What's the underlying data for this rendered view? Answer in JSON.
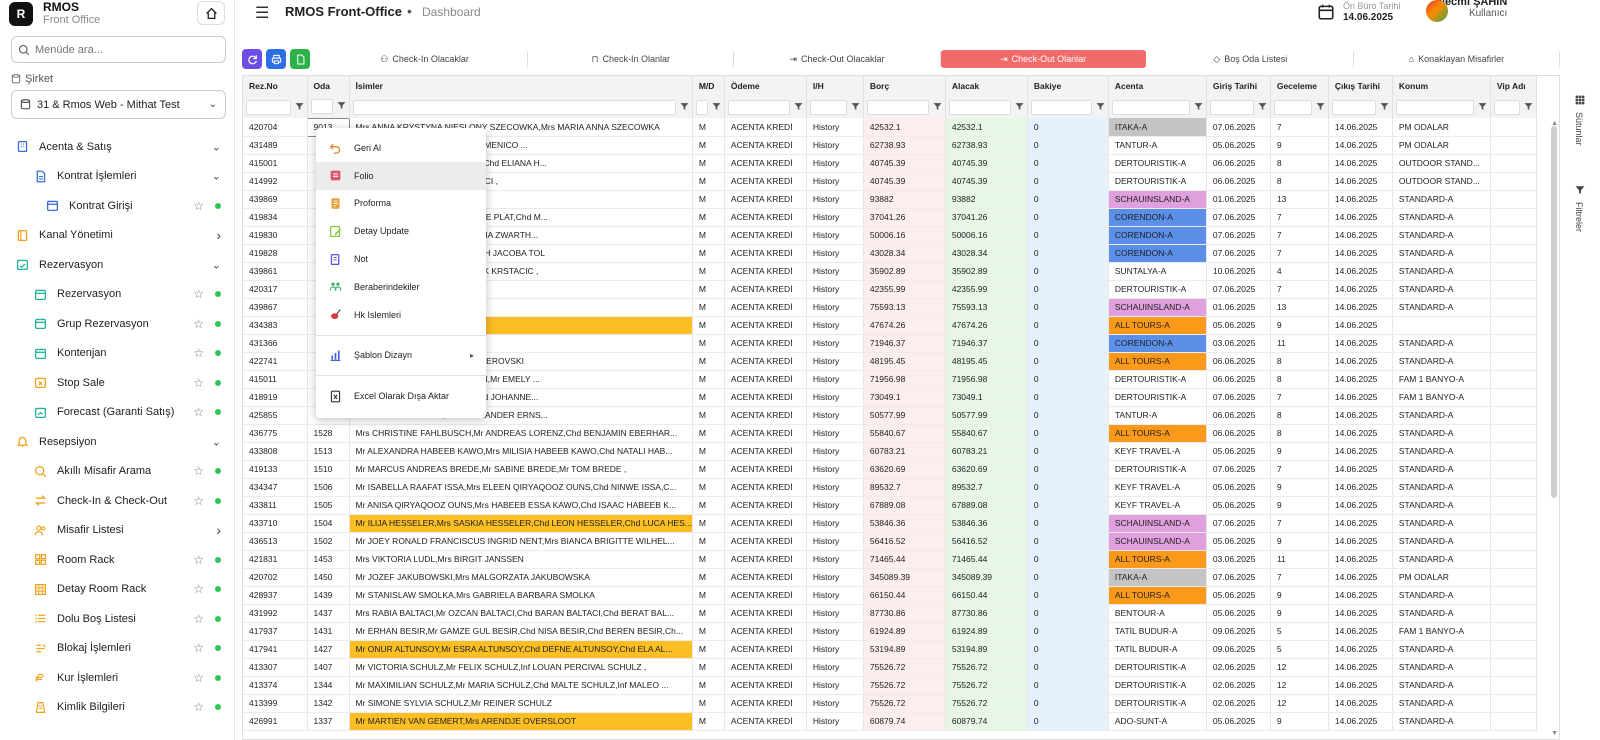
{
  "brand": {
    "name": "RMOS",
    "subtitle": "Front Office",
    "logo_letter": "R"
  },
  "sidebar": {
    "search_placeholder": "Menüde ara...",
    "company_label": "Şirket",
    "company_value": "31 & Rmos Web - Mithat Test",
    "items": [
      {
        "label": "Acenta & Satış",
        "icon": "building-icon",
        "level": 0,
        "chevron": "down",
        "star": false,
        "dot": false
      },
      {
        "label": "Kontrat İşlemleri",
        "icon": "document-icon",
        "level": 1,
        "chevron": "down",
        "star": false,
        "dot": false
      },
      {
        "label": "Kontrat Girişi",
        "icon": "calendar-icon",
        "level": 2,
        "chevron": "",
        "star": true,
        "dot": true
      },
      {
        "label": "Kanal Yönetimi",
        "icon": "book-icon",
        "level": 0,
        "chevron": "right",
        "star": false,
        "dot": false
      },
      {
        "label": "Rezervasyon",
        "icon": "calendar-check-icon",
        "level": 0,
        "chevron": "down",
        "star": false,
        "dot": false
      },
      {
        "label": "Rezervasyon",
        "icon": "calendar-icon",
        "level": 1,
        "chevron": "",
        "star": true,
        "dot": true
      },
      {
        "label": "Grup Rezervasyon",
        "icon": "calendar-icon",
        "level": 1,
        "chevron": "",
        "star": true,
        "dot": true
      },
      {
        "label": "Kontenjan",
        "icon": "calendar-icon",
        "level": 1,
        "chevron": "",
        "star": true,
        "dot": true
      },
      {
        "label": "Stop Sale",
        "icon": "stop-icon",
        "level": 1,
        "chevron": "",
        "star": true,
        "dot": true
      },
      {
        "label": "Forecast (Garanti Satış)",
        "icon": "forecast-icon",
        "level": 1,
        "chevron": "",
        "star": true,
        "dot": true
      },
      {
        "label": "Resepsiyon",
        "icon": "bell-icon",
        "level": 0,
        "chevron": "down",
        "star": false,
        "dot": false
      },
      {
        "label": "Akıllı Misafir Arama",
        "icon": "search-icon",
        "level": 1,
        "chevron": "",
        "star": true,
        "dot": true
      },
      {
        "label": "Check-In & Check-Out",
        "icon": "swap-icon",
        "level": 1,
        "chevron": "",
        "star": true,
        "dot": true
      },
      {
        "label": "Misafir Listesi",
        "icon": "users-icon",
        "level": 1,
        "chevron": "right",
        "star": false,
        "dot": false
      },
      {
        "label": "Room Rack",
        "icon": "grid-icon",
        "level": 1,
        "chevron": "",
        "star": true,
        "dot": true
      },
      {
        "label": "Detay Room Rack",
        "icon": "table-icon",
        "level": 1,
        "chevron": "",
        "star": true,
        "dot": true
      },
      {
        "label": "Dolu Boş Listesi",
        "icon": "list-icon",
        "level": 1,
        "chevron": "",
        "star": true,
        "dot": true
      },
      {
        "label": "Blokaj İşlemleri",
        "icon": "block-icon",
        "level": 1,
        "chevron": "",
        "star": true,
        "dot": true
      },
      {
        "label": "Kur İşlemleri",
        "icon": "currency-icon",
        "level": 1,
        "chevron": "",
        "star": true,
        "dot": true
      },
      {
        "label": "Kimlik Bilgileri",
        "icon": "id-card-icon",
        "level": 1,
        "chevron": "",
        "star": true,
        "dot": true
      }
    ]
  },
  "header": {
    "app_title": "RMOS Front-Office",
    "breadcrumb": "Dashboard",
    "date_label": "Ön Büro Tarihi",
    "date_value": "14.06.2025",
    "user_name": "Necmi ŞAHİN",
    "user_role": "Kullanıcı"
  },
  "toolbar": {
    "tabs": [
      {
        "label": "Check-In Olacaklar",
        "icon": "user-check-icon",
        "active": false
      },
      {
        "label": "Check-In Olanlar",
        "icon": "door-icon",
        "active": false
      },
      {
        "label": "Check-Out Olacaklar",
        "icon": "logout-icon",
        "active": false
      },
      {
        "label": "Check-Out Olanlar",
        "icon": "logout-icon",
        "active": true
      },
      {
        "label": "Boş Oda Listesi",
        "icon": "shield-icon",
        "active": false
      },
      {
        "label": "Konaklayan Misafirler",
        "icon": "home-icon",
        "active": false
      }
    ],
    "colors": {
      "refresh": "#6d4de6",
      "print": "#2f6fe6",
      "excel": "#2bb34a",
      "active_tab": "#f26b6b"
    }
  },
  "grid": {
    "columns": [
      "Rez.No",
      "Oda",
      "İsimler",
      "M/D",
      "Ödeme",
      "I/H",
      "Borç",
      "Alacak",
      "Bakiye",
      "Acenta",
      "Giriş Tarihi",
      "Geceleme",
      "Çıkış Tarihi",
      "Konum",
      "Vip Adı"
    ],
    "agency_colors": {
      "gray": "#c4c4c4",
      "pink": "#e0a0dd",
      "blue": "#5b8fe8",
      "orange": "#fb9a1a"
    },
    "rows": [
      [
        "420704",
        "9013",
        "Mrs ANNA KRYSTYNA NIESLONY SZECOWKA,Mrs MARIA ANNA SZECOWKA",
        "M",
        "ACENTA KREDİ",
        "History",
        "42532.1",
        "42532.1",
        "0",
        "ITAKA-A",
        "07.06.2025",
        "7",
        "14.06.2025",
        "PM ODALAR",
        "",
        "gray",
        false
      ],
      [
        "431489",
        "",
        "Mr ANTONIO LA MANNA,Chd DOMENICO ...",
        "M",
        "ACENTA KREDİ",
        "History",
        "62738.93",
        "62738.93",
        "0",
        "TANTUR-A",
        "05.06.2025",
        "9",
        "14.06.2025",
        "PM ODALAR",
        "",
        "",
        false
      ],
      [
        "415001",
        "",
        "ANIE HORNBERGER FECHTER,Chd ELIANA H...",
        "M",
        "ACENTA KREDİ",
        "History",
        "40745.39",
        "40745.39",
        "0",
        "DERTOURISTIK-A",
        "06.06.2025",
        "8",
        "14.06.2025",
        "OUTDOOR STAND...",
        "",
        "",
        false
      ],
      [
        "414992",
        "",
        "ABANCI,Inf CAN HIKMET SABANCI ,",
        "M",
        "ACENTA KREDİ",
        "History",
        "40745.39",
        "40745.39",
        "0",
        "DERTOURISTIK-A",
        "06.06.2025",
        "8",
        "14.06.2025",
        "OUTDOOR STAND...",
        "",
        "",
        false
      ],
      [
        "439869",
        "",
        "O GASHI,Mrs JENNIFER GASHI ,",
        "M",
        "ACENTA KREDİ",
        "History",
        "93882",
        "93882",
        "0",
        "SCHAUINSLAND-A",
        "01.06.2025",
        "13",
        "14.06.2025",
        "STANDARD-A",
        "",
        "pink",
        false
      ],
      [
        "419834",
        "",
        "NNES RUNDERKAMP,Mrs DENISE PLAT,Chd M...",
        "M",
        "ACENTA KREDİ",
        "History",
        "37041.26",
        "37041.26",
        "0",
        "CORENDON-A",
        "07.06.2025",
        "7",
        "14.06.2025",
        "STANDARD-A",
        "",
        "blue",
        false
      ],
      [
        "419830",
        "",
        "ZUNDERKAMP,Mrs GEZINA MARIA ZWARTH...",
        "M",
        "ACENTA KREDİ",
        "History",
        "50006.16",
        "50006.16",
        "0",
        "CORENDON-A",
        "07.06.2025",
        "7",
        "14.06.2025",
        "STANDARD-A",
        "",
        "blue",
        false
      ],
      [
        "419828",
        "",
        "IDERKAMP,Mrs ALIDA ELISABETH JACOBA TOL",
        "M",
        "ACENTA KREDİ",
        "History",
        "43028.34",
        "43028.34",
        "0",
        "CORENDON-A",
        "07.06.2025",
        "7",
        "14.06.2025",
        "STANDARD-A",
        "",
        "blue",
        false
      ],
      [
        "439861",
        "",
        "TIJAN KRSTACIC,Mr DEJAN RICK KRSTACIC ,",
        "M",
        "ACENTA KREDİ",
        "History",
        "35902.89",
        "35902.89",
        "0",
        "SUNTALYA-A",
        "10.06.2025",
        "4",
        "14.06.2025",
        "STANDARD-A",
        "",
        "",
        false
      ],
      [
        "420317",
        "",
        "BINIAN LUCIUS RICHA PICKAR",
        "M",
        "ACENTA KREDİ",
        "History",
        "42355.99",
        "42355.99",
        "0",
        "DERTOURISTIK-A",
        "07.06.2025",
        "7",
        "14.06.2025",
        "STANDARD-A",
        "",
        "",
        false
      ],
      [
        "439867",
        "",
        "SHI",
        "M",
        "ACENTA KREDİ",
        "History",
        "75593.13",
        "75593.13",
        "0",
        "SCHAUINSLAND-A",
        "01.06.2025",
        "13",
        "14.06.2025",
        "STANDARD-A",
        "",
        "pink",
        false
      ],
      [
        "434383",
        "",
        "",
        "M",
        "ACENTA KREDİ",
        "History",
        "47674.26",
        "47674.26",
        "0",
        "ALL TOURS-A",
        "05.06.2025",
        "9",
        "14.06.2025",
        "",
        "",
        "orange",
        true
      ],
      [
        "431366",
        "",
        "BENJAMINS",
        "M",
        "ACENTA KREDİ",
        "History",
        "71946.37",
        "71946.37",
        "0",
        "CORENDON-A",
        "03.06.2025",
        "11",
        "14.06.2025",
        "STANDARD-A",
        "",
        "blue",
        false
      ],
      [
        "422741",
        "",
        "VSKI,Mrs KATHRIN ELKE SKENDEROVSKI",
        "M",
        "ACENTA KREDİ",
        "History",
        "48195.45",
        "48195.45",
        "0",
        "ALL TOURS-A",
        "06.06.2025",
        "8",
        "14.06.2025",
        "STANDARD-A",
        "",
        "orange",
        false
      ],
      [
        "415011",
        "",
        "ANGELINA RUTH GEISSELMANN,Mr EMELY ...",
        "M",
        "ACENTA KREDİ",
        "History",
        "71956.98",
        "71956.98",
        "0",
        "DERTOURISTIK-A",
        "06.06.2025",
        "8",
        "14.06.2025",
        "FAM 1 BANYO-A",
        "",
        "",
        false
      ],
      [
        "418919",
        "",
        "MAAG,Mr SEBASTIAN MAAG,Chd JOHANNE...",
        "M",
        "ACENTA KREDİ",
        "History",
        "73049.1",
        "73049.1",
        "0",
        "DERTOURISTIK-A",
        "07.06.2025",
        "7",
        "14.06.2025",
        "FAM 1 BANYO-A",
        "",
        "",
        false
      ],
      [
        "425855",
        "",
        "Mr MARIUSZ LIPINSKI,Chd ALEXANDER ERNS...",
        "M",
        "ACENTA KREDİ",
        "History",
        "50577.99",
        "50577.99",
        "0",
        "TANTUR-A",
        "06.06.2025",
        "8",
        "14.06.2025",
        "STANDARD-A",
        "",
        "",
        false
      ],
      [
        "436775",
        "1528",
        "Mrs CHRISTINE FAHLBUSCH,Mr ANDREAS LORENZ,Chd BENJAMIN EBERHAR...",
        "M",
        "ACENTA KREDİ",
        "History",
        "55840.67",
        "55840.67",
        "0",
        "ALL TOURS-A",
        "06.06.2025",
        "8",
        "14.06.2025",
        "STANDARD-A",
        "",
        "orange",
        false
      ],
      [
        "433808",
        "1513",
        "Mr ALEXANDRA HABEEB KAWO,Mrs MILISIA HABEEB KAWO,Chd NATALI HAB...",
        "M",
        "ACENTA KREDİ",
        "History",
        "60783.21",
        "60783.21",
        "0",
        "KEYF TRAVEL-A",
        "05.06.2025",
        "9",
        "14.06.2025",
        "STANDARD-A",
        "",
        "",
        false
      ],
      [
        "419133",
        "1510",
        "Mr MARCUS ANDREAS BREDE,Mr SABINE BREDE,Mr TOM BREDE ,",
        "M",
        "ACENTA KREDİ",
        "History",
        "63620.69",
        "63620.69",
        "0",
        "DERTOURISTIK-A",
        "07.06.2025",
        "7",
        "14.06.2025",
        "STANDARD-A",
        "",
        "",
        false
      ],
      [
        "434347",
        "1506",
        "Mr ISABELLA RAAFAT ISSA,Mrs ELEEN QIRYAQOOZ OUNS,Chd NINWE ISSA,C...",
        "M",
        "ACENTA KREDİ",
        "History",
        "89532.7",
        "89532.7",
        "0",
        "KEYF TRAVEL-A",
        "05.06.2025",
        "9",
        "14.06.2025",
        "STANDARD-A",
        "",
        "",
        false
      ],
      [
        "433811",
        "1505",
        "Mr ANISA QIRYAQOOZ OUNS,Mrs HABEEB ESSA KAWO,Chd ISAAC HABEEB K...",
        "M",
        "ACENTA KREDİ",
        "History",
        "67889.08",
        "67889.08",
        "0",
        "KEYF TRAVEL-A",
        "05.06.2025",
        "9",
        "14.06.2025",
        "STANDARD-A",
        "",
        "",
        false
      ],
      [
        "433710",
        "1504",
        "Mr ILIJA HESSELER,Mrs SASKIA HESSELER,Chd LEON HESSELER,Chd LUCA HES...",
        "M",
        "ACENTA KREDİ",
        "History",
        "53846.36",
        "53846.36",
        "0",
        "SCHAUINSLAND-A",
        "07.06.2025",
        "7",
        "14.06.2025",
        "STANDARD-A",
        "",
        "pink",
        true
      ],
      [
        "436513",
        "1502",
        "Mr JOEY RONALD FRANCISCUS INGRID NENT,Mrs BIANCA BRIGITTE WILHEL...",
        "M",
        "ACENTA KREDİ",
        "History",
        "56416.52",
        "56416.52",
        "0",
        "SCHAUINSLAND-A",
        "05.06.2025",
        "9",
        "14.06.2025",
        "STANDARD-A",
        "",
        "pink",
        false
      ],
      [
        "421831",
        "1453",
        "Mrs VIKTORIA LUDL,Mrs BIRGIT JANSSEN",
        "M",
        "ACENTA KREDİ",
        "History",
        "71465.44",
        "71465.44",
        "0",
        "ALL TOURS-A",
        "03.06.2025",
        "11",
        "14.06.2025",
        "STANDARD-A",
        "",
        "orange",
        false
      ],
      [
        "420702",
        "1450",
        "Mr JOZEF JAKUBOWSKI,Mrs MALGORZATA JAKUBOWSKA",
        "M",
        "ACENTA KREDİ",
        "History",
        "345089.39",
        "345089.39",
        "0",
        "ITAKA-A",
        "07.06.2025",
        "7",
        "14.06.2025",
        "PM ODALAR",
        "",
        "gray",
        false
      ],
      [
        "428937",
        "1439",
        "Mr STANISLAW SMOLKA,Mrs GABRIELA BARBARA SMOLKA",
        "M",
        "ACENTA KREDİ",
        "History",
        "66150.44",
        "66150.44",
        "0",
        "ALL TOURS-A",
        "05.06.2025",
        "9",
        "14.06.2025",
        "STANDARD-A",
        "",
        "orange",
        false
      ],
      [
        "431992",
        "1437",
        "Mrs RABIA BALTACI,Mr OZCAN BALTACI,Chd BARAN BALTACI,Chd BERAT BAL...",
        "M",
        "ACENTA KREDİ",
        "History",
        "87730.86",
        "87730.86",
        "0",
        "BENTOUR-A",
        "05.06.2025",
        "9",
        "14.06.2025",
        "STANDARD-A",
        "",
        "",
        false
      ],
      [
        "417937",
        "1431",
        "Mr ERHAN BESIR,Mr GAMZE GUL BESIR,Chd NISA BESIR,Chd BEREN BESIR,Ch...",
        "M",
        "ACENTA KREDİ",
        "History",
        "61924.89",
        "61924.89",
        "0",
        "TATİL BUDUR-A",
        "09.06.2025",
        "5",
        "14.06.2025",
        "FAM 1 BANYO-A",
        "",
        "",
        false
      ],
      [
        "417941",
        "1427",
        "Mr ONUR ALTUNSOY,Mr ESRA ALTUNSOY,Chd DEFNE ALTUNSOY,Chd ELA AL...",
        "M",
        "ACENTA KREDİ",
        "History",
        "53194.89",
        "53194.89",
        "0",
        "TATİL BUDUR-A",
        "09.06.2025",
        "5",
        "14.06.2025",
        "STANDARD-A",
        "",
        "",
        true
      ],
      [
        "413307",
        "1407",
        "Mr VICTORIA SCHULZ,Mr FELIX SCHULZ,Inf LOUAN PERCIVAL SCHULZ ,",
        "M",
        "ACENTA KREDİ",
        "History",
        "75526.72",
        "75526.72",
        "0",
        "DERTOURISTIK-A",
        "02.06.2025",
        "12",
        "14.06.2025",
        "STANDARD-A",
        "",
        "",
        false
      ],
      [
        "413374",
        "1344",
        "Mr MAXIMILIAN SCHULZ,Mr MARIA SCHULZ,Chd MALTE SCHULZ,Inf MALEO ...",
        "M",
        "ACENTA KREDİ",
        "History",
        "75526.72",
        "75526.72",
        "0",
        "DERTOURISTIK-A",
        "02.06.2025",
        "12",
        "14.06.2025",
        "STANDARD-A",
        "",
        "",
        false
      ],
      [
        "413399",
        "1342",
        "Mr SIMONE SYLVIA SCHULZ,Mr REINER SCHULZ",
        "M",
        "ACENTA KREDİ",
        "History",
        "75526.72",
        "75526.72",
        "0",
        "DERTOURISTIK-A",
        "02.06.2025",
        "12",
        "14.06.2025",
        "STANDARD-A",
        "",
        "",
        false
      ],
      [
        "426991",
        "1337",
        "Mr MARTIEN VAN GEMERT,Mrs ARENDJE OVERSLOOT",
        "M",
        "ACENTA KREDİ",
        "History",
        "60879.74",
        "60879.74",
        "0",
        "ADO-SUNT-A",
        "05.06.2025",
        "9",
        "14.06.2025",
        "STANDARD-A",
        "",
        "",
        true
      ]
    ]
  },
  "right_panel": {
    "columns_label": "Sütunlar",
    "filters_label": "Filtreler"
  },
  "context_menu": {
    "items": [
      {
        "label": "Geri Al",
        "icon": "undo-icon",
        "color": "#e08a2e",
        "highlight": false,
        "submenu": false
      },
      {
        "label": "Folio",
        "icon": "folio-icon",
        "color": "#e0566e",
        "highlight": true,
        "submenu": false
      },
      {
        "label": "Proforma",
        "icon": "proforma-icon",
        "color": "#e6a23c",
        "highlight": false,
        "submenu": false
      },
      {
        "label": "Detay Update",
        "icon": "edit-icon",
        "color": "#8cc63e",
        "highlight": false,
        "submenu": false
      },
      {
        "label": "Not",
        "icon": "note-icon",
        "color": "#6b4fd8",
        "highlight": false,
        "submenu": false
      },
      {
        "label": "Beraberindekiler",
        "icon": "group-icon",
        "color": "#37b36a",
        "highlight": false,
        "submenu": false
      },
      {
        "label": "Hk Islemleri",
        "icon": "broom-icon",
        "color": "#d93838",
        "highlight": false,
        "submenu": false
      },
      {
        "label": "Şablon Dizayn",
        "icon": "chart-bars-icon",
        "color": "#3a5fd9",
        "highlight": false,
        "submenu": true
      },
      {
        "label": "Excel Olarak Dışa Aktar",
        "icon": "excel-icon",
        "color": "#333333",
        "highlight": false,
        "submenu": false
      }
    ]
  }
}
